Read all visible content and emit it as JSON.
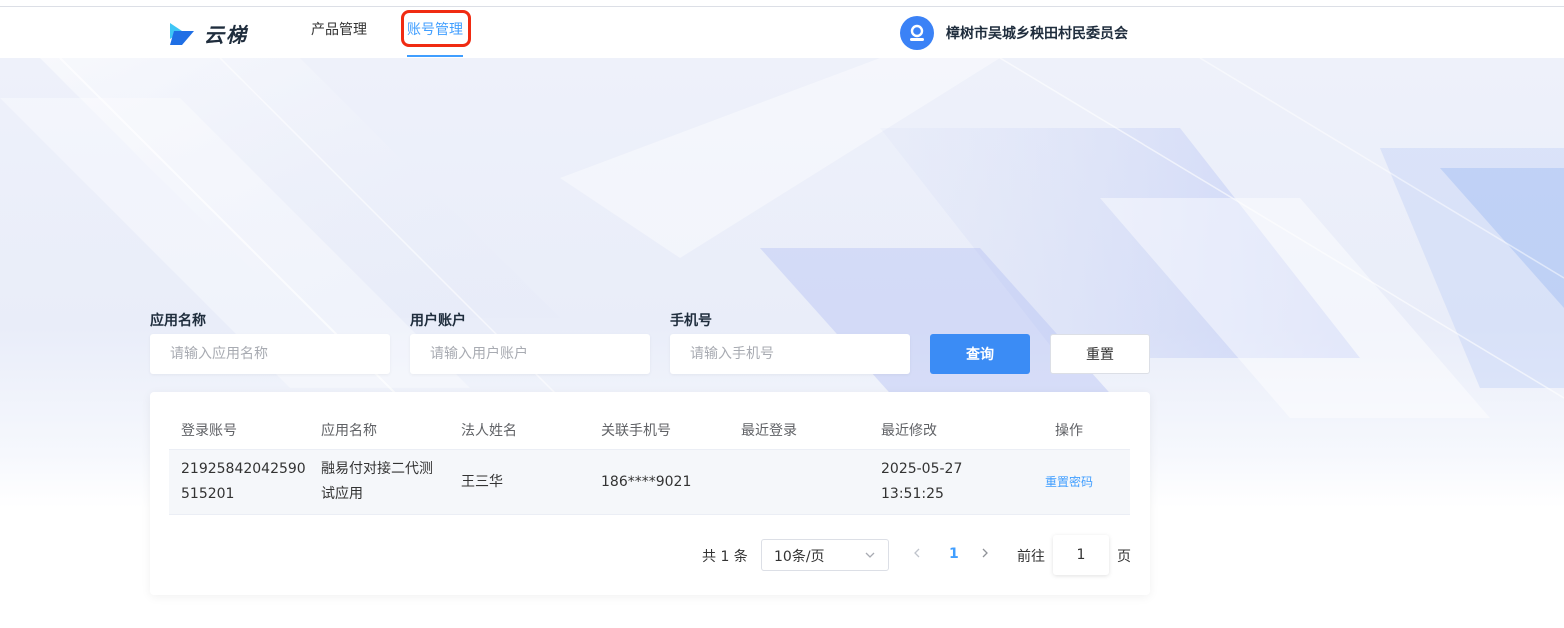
{
  "header": {
    "brand": "云梯",
    "nav": [
      {
        "label": "产品管理"
      },
      {
        "label": "账号管理"
      }
    ],
    "org_name": "樟树市吴城乡秧田村民委员会"
  },
  "filters": {
    "app_name": {
      "label": "应用名称",
      "placeholder": "请输入应用名称"
    },
    "account": {
      "label": "用户账户",
      "placeholder": "请输入用户账户"
    },
    "phone": {
      "label": "手机号",
      "placeholder": "请输入手机号"
    },
    "query_label": "查询",
    "reset_label": "重置"
  },
  "table": {
    "columns": [
      "登录账号",
      "应用名称",
      "法人姓名",
      "关联手机号",
      "最近登录",
      "最近修改",
      "操作"
    ],
    "rows": [
      {
        "login_line1": "21925842042590",
        "login_line2": "515201",
        "app_line1": "融易付对接二代测",
        "app_line2": "试应用",
        "legal_name": "王三华",
        "phone": "186****9021",
        "last_login": "",
        "modified_date": "2025-05-27",
        "modified_time": "13:51:25",
        "action": "重置密码"
      }
    ]
  },
  "pagination": {
    "total": "共 1 条",
    "page_size": "10条/页",
    "current_page": "1",
    "goto_label": "前往",
    "goto_value": "1",
    "goto_unit": "页"
  },
  "colors": {
    "accent": "#409eff",
    "primary_button": "#3b8cf5",
    "highlight": "#f02b12"
  }
}
